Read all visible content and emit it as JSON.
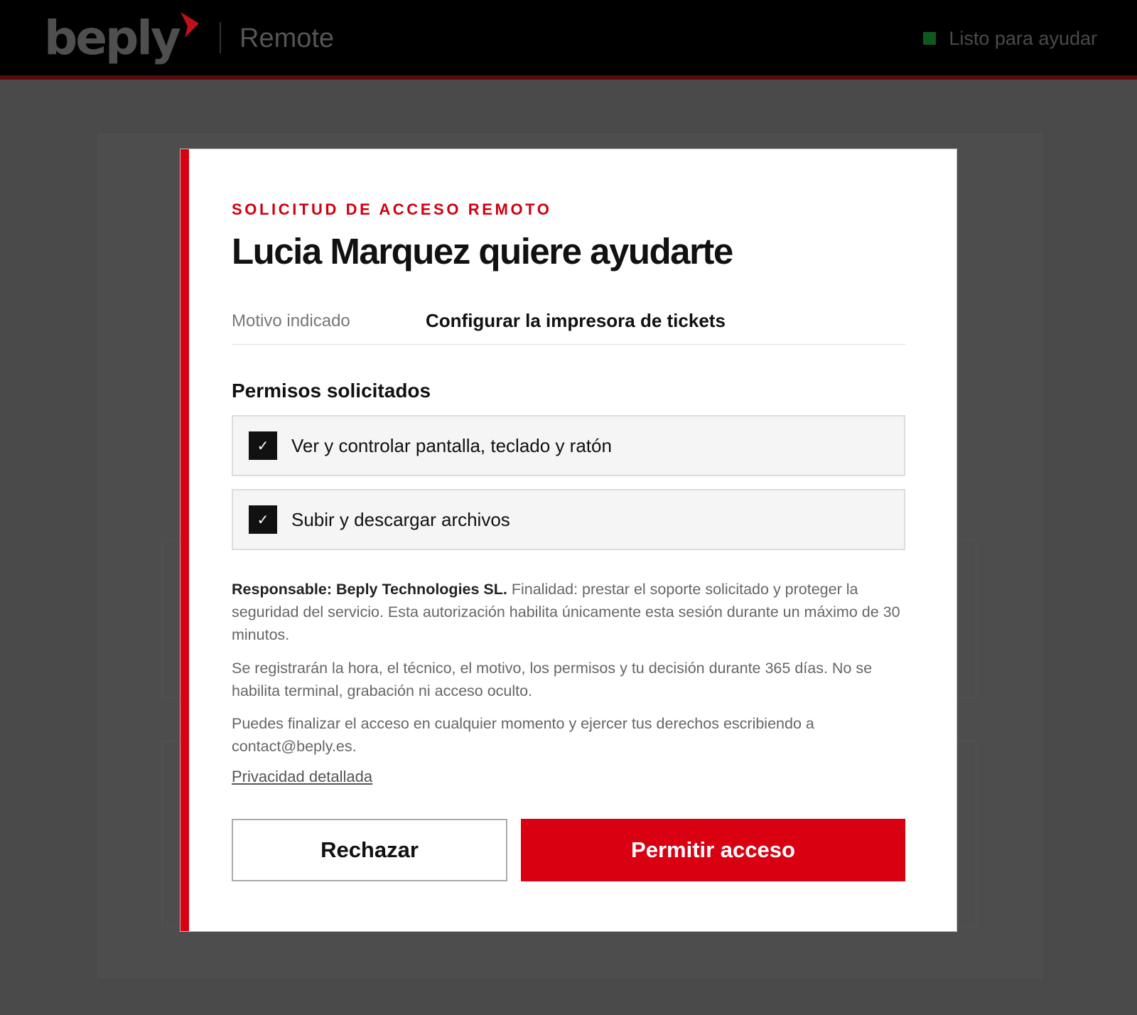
{
  "header": {
    "brand": "beply",
    "product": "Remote",
    "status_text": "Listo para ayudar",
    "status_color": "#0e5a1e"
  },
  "colors": {
    "accent": "#d90012",
    "text": "#111111",
    "muted": "#666666"
  },
  "dialog": {
    "eyebrow": "SOLICITUD DE ACCESO REMOTO",
    "title": "Lucia Marquez quiere ayudarte",
    "reason_label": "Motivo indicado",
    "reason_value": "Configurar la impresora de tickets",
    "permissions_title": "Permisos solicitados",
    "permissions": [
      {
        "label": "Ver y controlar pantalla, teclado y ratón",
        "checked": true,
        "check_glyph": "✓"
      },
      {
        "label": "Subir y descargar archivos",
        "checked": true,
        "check_glyph": "✓"
      }
    ],
    "legal": {
      "responsable": "Responsable: Beply Technologies SL.",
      "paragraph_1": "Finalidad: prestar el soporte solicitado y proteger la seguridad del servicio. Esta autorización habilita únicamente esta sesión durante un máximo de 30 minutos.",
      "paragraph_2": "Se registrarán la hora, el técnico, el motivo, los permisos y tu decisión durante 365 días. No se habilita terminal, grabación ni acceso oculto.",
      "paragraph_3": "Puedes finalizar el acceso en cualquier momento y ejercer tus derechos escribiendo a contact@beply.es."
    },
    "privacy_link": "Privacidad detallada",
    "reject_label": "Rechazar",
    "allow_label": "Permitir acceso"
  }
}
